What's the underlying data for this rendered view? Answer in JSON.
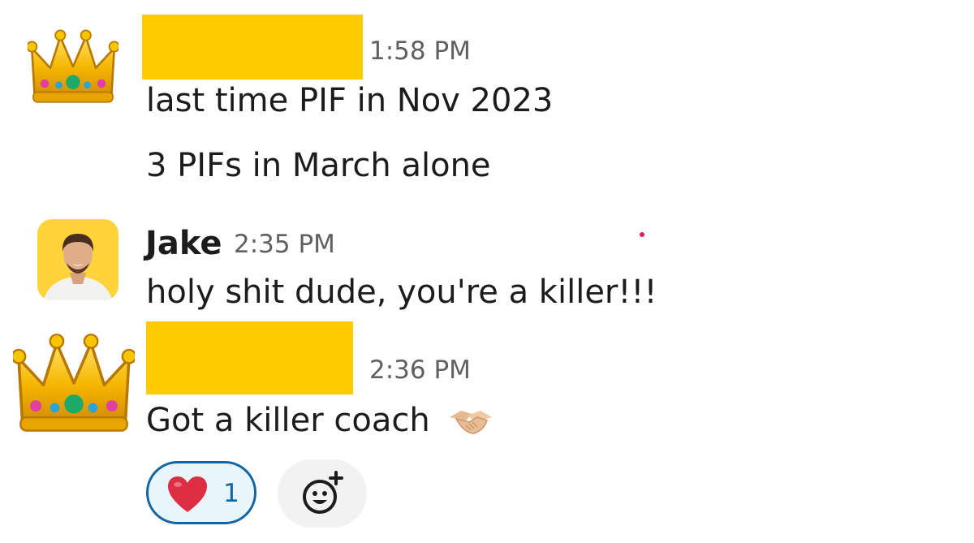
{
  "colors": {
    "redaction": "#ffcc00",
    "timestamp": "#616061",
    "text": "#1d1c1d",
    "reaction_border": "#1264a3",
    "reaction_background": "#e8f5fa",
    "add_reaction_background": "#f2f2f2",
    "presence_dot": "#e01e5a"
  },
  "messages": [
    {
      "avatar_icon": "crown-icon",
      "sender_redacted": true,
      "time": "1:58 PM",
      "lines": [
        "last time PIF in Nov 2023",
        "3 PIFs in March alone"
      ]
    },
    {
      "avatar_icon": "person-photo",
      "sender": "Jake",
      "time": "2:35 PM",
      "lines": [
        "holy shit dude, you're a killer!!!"
      ]
    },
    {
      "avatar_icon": "crown-icon",
      "sender_redacted": true,
      "time": "2:36 PM",
      "lines": [
        "Got a killer coach"
      ],
      "trailing_emoji": "handshake-icon",
      "reactions": [
        {
          "emoji": "red-heart-icon",
          "count": "1",
          "selected": true
        }
      ],
      "add_reaction_icon": "add-emoji-icon"
    }
  ]
}
